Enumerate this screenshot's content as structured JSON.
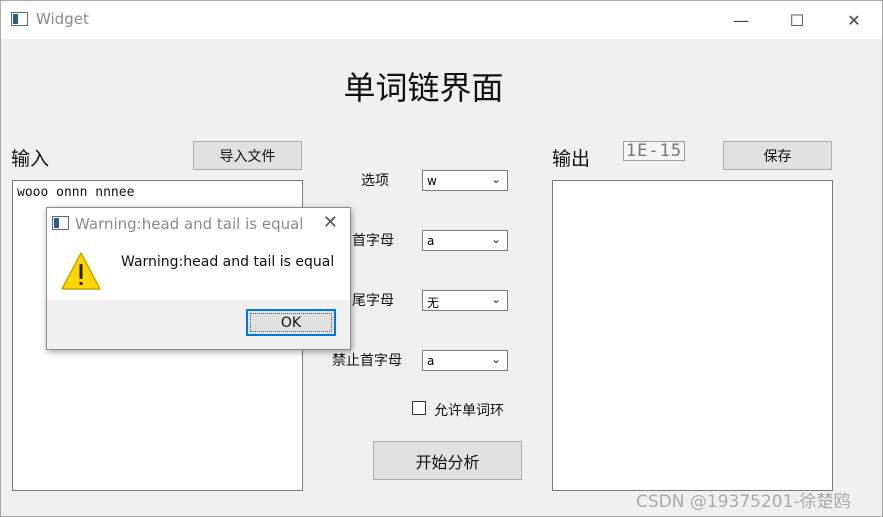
{
  "window": {
    "title": "Widget",
    "controls": {
      "minimize": "—",
      "maximize": "☐",
      "close": "✕"
    }
  },
  "page": {
    "title": "单词链界面"
  },
  "input_panel": {
    "label": "输入",
    "import_button": "导入文件",
    "text": "wooo onnn nnnee"
  },
  "options": {
    "mode": {
      "label": "选项",
      "value": "w"
    },
    "head": {
      "label": "首字母",
      "value": "a"
    },
    "tail": {
      "label": "尾字母",
      "value": "无"
    },
    "forbid": {
      "label": "禁止首字母",
      "value": "a"
    },
    "allow_cycle": {
      "label": "允许单词环",
      "checked": false
    },
    "start_button": "开始分析"
  },
  "output_panel": {
    "label": "输出",
    "lcd_value": "1E-15",
    "save_button": "保存",
    "text": ""
  },
  "dialog": {
    "title": "Warning:head and tail is equal",
    "message": "Warning:head and tail is equal",
    "ok_button": "OK",
    "icon": "warning-icon",
    "close_glyph": "✕"
  },
  "watermark": "CSDN @19375201-徐楚鸥",
  "colors": {
    "focus_border": "#0078d7",
    "warning_fill": "#ffd700"
  }
}
